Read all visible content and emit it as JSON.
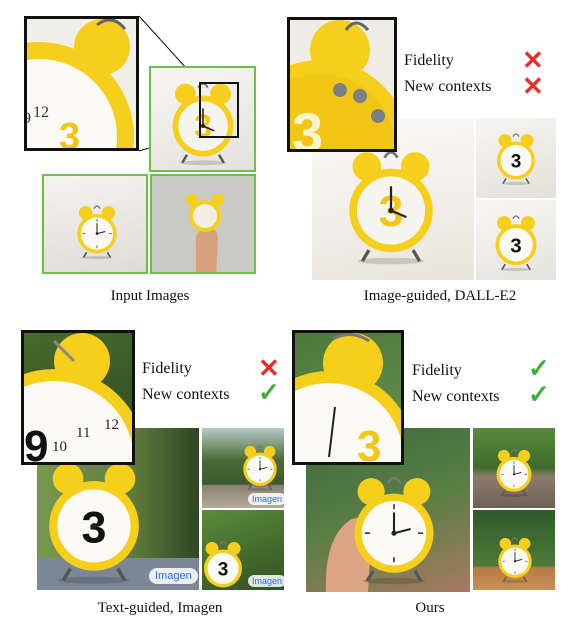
{
  "captions": {
    "input": "Input Images",
    "dalle": "Image-guided, DALL-E2",
    "imagen": "Text-guided, Imagen",
    "ours": "Ours"
  },
  "criteria": {
    "fidelity": "Fidelity",
    "new_contexts": "New contexts"
  },
  "marks": {
    "cross": "✕",
    "check": "✓",
    "cross_color": "#e8302a",
    "check_color": "#3fae3a"
  },
  "results": {
    "dalle": {
      "fidelity": "cross",
      "new_contexts": "cross"
    },
    "imagen": {
      "fidelity": "cross",
      "new_contexts": "check"
    },
    "ours": {
      "fidelity": "check",
      "new_contexts": "check"
    }
  },
  "watermark": "Imagen",
  "clock_numerals": {
    "big": "3",
    "top": "12",
    "side": "9",
    "nine_left": "9",
    "eleven": "11",
    "ten": "10",
    "twelve": "12"
  }
}
